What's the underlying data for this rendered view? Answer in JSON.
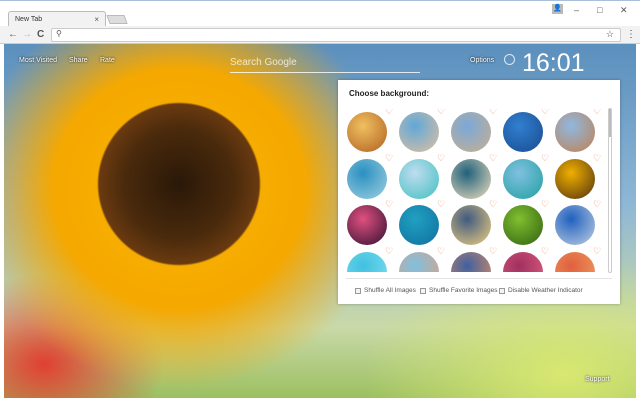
{
  "browser": {
    "tab_title": "New Tab",
    "tab_close": "×",
    "min": "–",
    "max": "□",
    "close": "✕",
    "back": "←",
    "forward": "→",
    "reload": "C",
    "search_icon": "⚲",
    "star": "☆",
    "menu": "⋮",
    "user": "👤"
  },
  "page": {
    "links": [
      "Most Visited",
      "Share",
      "Rate"
    ],
    "search_placeholder": "Search Google",
    "options": "Options",
    "time": "16:01",
    "support": "Support"
  },
  "panel": {
    "title": "Choose background:",
    "heart": "♡",
    "thumbs": [
      {
        "colors": [
          "#f0c060",
          "#b06020"
        ]
      },
      {
        "colors": [
          "#60a8d8",
          "#e0c0a0"
        ]
      },
      {
        "colors": [
          "#7aa8d8",
          "#c8b090"
        ]
      },
      {
        "colors": [
          "#3080d0",
          "#1a4a90"
        ]
      },
      {
        "colors": [
          "#90b8e0",
          "#c08050"
        ]
      },
      {
        "colors": [
          "#2a90c0",
          "#a0d0e0"
        ]
      },
      {
        "colors": [
          "#c0dcf0",
          "#40c0c0"
        ]
      },
      {
        "colors": [
          "#20607a",
          "#f0e0c0"
        ]
      },
      {
        "colors": [
          "#80c0e0",
          "#20a0a0"
        ]
      },
      {
        "colors": [
          "#f0b000",
          "#503010"
        ]
      },
      {
        "colors": [
          "#e05080",
          "#301030"
        ]
      },
      {
        "colors": [
          "#20a0c0",
          "#1070a0"
        ]
      },
      {
        "colors": [
          "#405a80",
          "#f0d080"
        ]
      },
      {
        "colors": [
          "#80c030",
          "#306010"
        ]
      },
      {
        "colors": [
          "#2060c0",
          "#c0d0e0"
        ]
      },
      {
        "colors": [
          "#40c0e0",
          "#80e0f0"
        ]
      },
      {
        "colors": [
          "#80c0e0",
          "#e0a080"
        ]
      },
      {
        "colors": [
          "#4060a0",
          "#e09060"
        ]
      },
      {
        "colors": [
          "#a03060",
          "#e06080"
        ]
      },
      {
        "colors": [
          "#e06040",
          "#f0a060"
        ]
      }
    ],
    "options": [
      "Shuffle All Images",
      "Shuffle Favorite Images",
      "Disable Weather Indicator"
    ]
  }
}
